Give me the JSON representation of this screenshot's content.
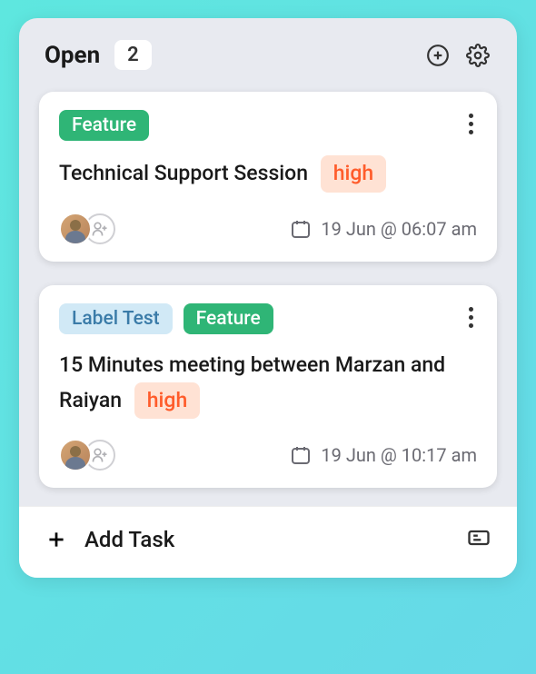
{
  "header": {
    "title": "Open",
    "count": "2"
  },
  "tasks": [
    {
      "labels": [
        {
          "text": "Feature",
          "class": "label-feature"
        }
      ],
      "title": "Technical Support Session",
      "priority": "high",
      "date": "19 Jun @ 06:07 am"
    },
    {
      "labels": [
        {
          "text": "Label Test",
          "class": "label-test"
        },
        {
          "text": "Feature",
          "class": "label-feature"
        }
      ],
      "title": "15 Minutes meeting between Marzan and Raiyan",
      "priority": "high",
      "date": "19 Jun @ 10:17 am"
    }
  ],
  "footer": {
    "addTask": "Add Task"
  }
}
